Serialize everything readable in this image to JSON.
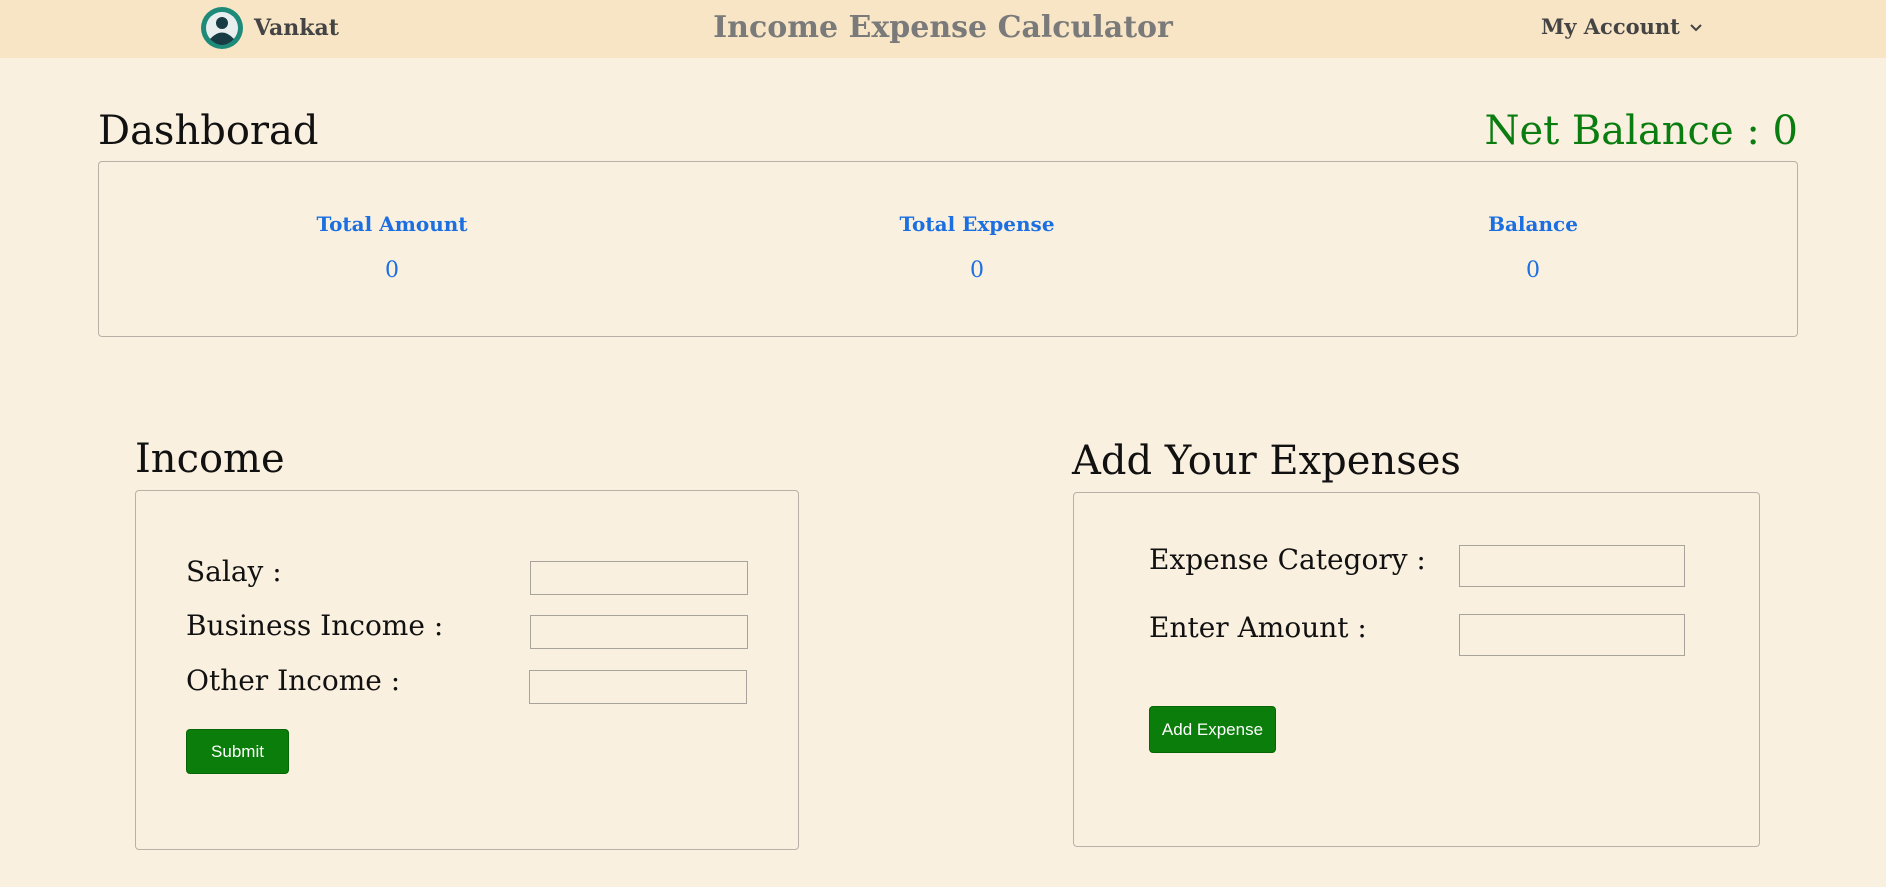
{
  "navbar": {
    "brand_name": "Vankat",
    "logo_icon": "user-avatar-icon",
    "title": "Income Expense Calculator",
    "account_label": "My Account",
    "account_icon": "chevron-down-icon"
  },
  "dashboard": {
    "title": "Dashborad",
    "net_balance_label": "Net Balance : ",
    "net_balance_value": "0",
    "stats": [
      {
        "label": "Total Amount",
        "value": "0"
      },
      {
        "label": "Total Expense",
        "value": "0"
      },
      {
        "label": "Balance",
        "value": "0"
      }
    ]
  },
  "income": {
    "title": "Income",
    "fields": [
      {
        "label": "Salay :",
        "value": "",
        "placeholder": ""
      },
      {
        "label": "Business Income :",
        "value": "",
        "placeholder": ""
      },
      {
        "label": "Other Income :",
        "value": "",
        "placeholder": ""
      }
    ],
    "submit_label": "Submit"
  },
  "expense": {
    "title": "Add Your Expenses",
    "fields": [
      {
        "label": "Expense Category :",
        "value": "",
        "placeholder": ""
      },
      {
        "label": "Enter Amount :",
        "value": "",
        "placeholder": ""
      }
    ],
    "add_label": "Add Expense"
  },
  "colors": {
    "navbar_bg": "#f8e5c5",
    "page_bg": "#faf0e0",
    "accent_blue": "#1b6fe0",
    "accent_green": "#0b7d10"
  }
}
